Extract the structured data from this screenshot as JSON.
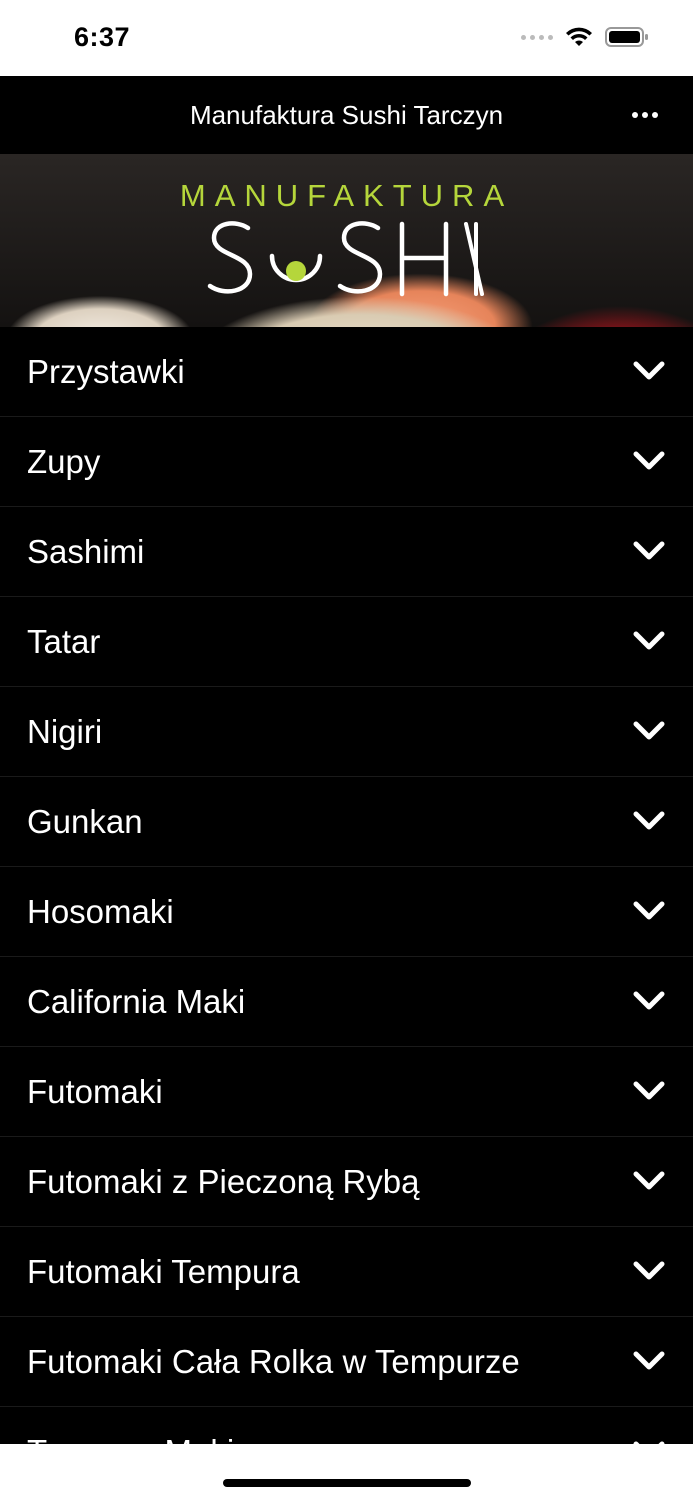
{
  "status_bar": {
    "time": "6:37"
  },
  "nav": {
    "title": "Manufaktura Sushi Tarczyn"
  },
  "banner": {
    "logo_top": "MANUFAKTURA",
    "logo_main": "SUSHI"
  },
  "menu": {
    "items": [
      {
        "label": "Przystawki"
      },
      {
        "label": "Zupy"
      },
      {
        "label": "Sashimi"
      },
      {
        "label": "Tatar"
      },
      {
        "label": "Nigiri"
      },
      {
        "label": "Gunkan"
      },
      {
        "label": "Hosomaki"
      },
      {
        "label": "California Maki"
      },
      {
        "label": "Futomaki"
      },
      {
        "label": "Futomaki z Pieczoną Rybą"
      },
      {
        "label": "Futomaki Tempura"
      },
      {
        "label": "Futomaki Cała Rolka w Tempurze"
      },
      {
        "label": "Tempura Maki"
      }
    ]
  },
  "icons": {
    "chevron": "chevron-down-icon",
    "more": "more-icon",
    "wifi": "wifi-icon",
    "battery": "battery-icon",
    "signal": "signal-icon"
  },
  "colors": {
    "background": "#000000",
    "logo_accent": "#b5d63b",
    "text": "#ffffff"
  }
}
